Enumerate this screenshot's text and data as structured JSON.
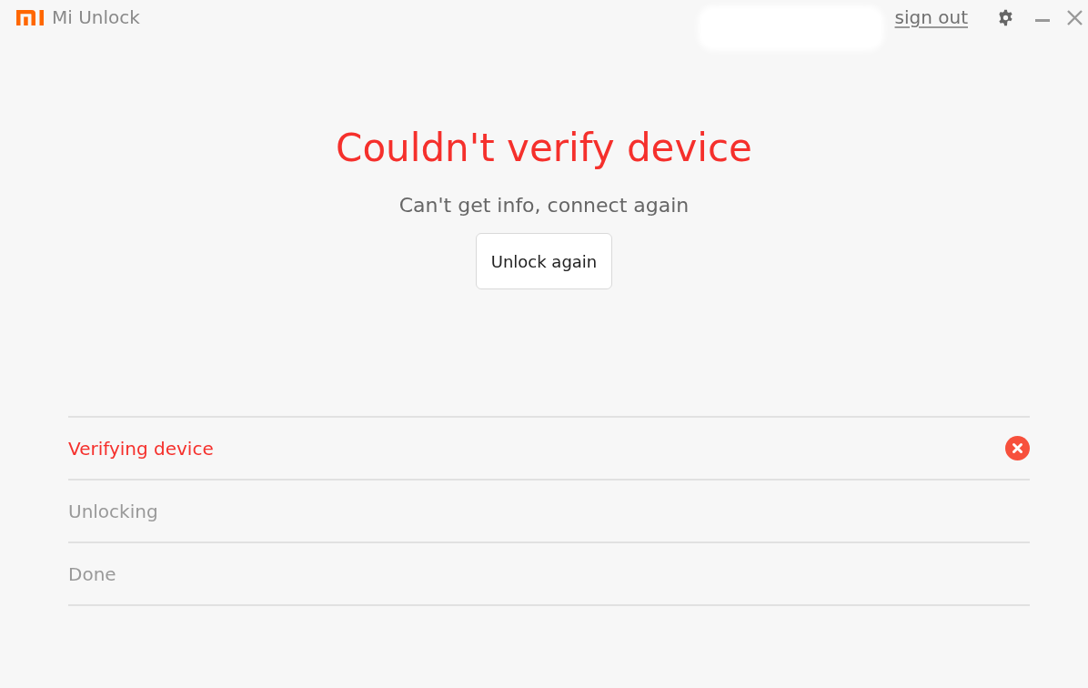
{
  "window": {
    "title": "Mi Unlock"
  },
  "account": {
    "sign_out": "sign out"
  },
  "message": {
    "title": "Couldn't verify device",
    "detail": "Can't get info, connect again",
    "button": "Unlock again"
  },
  "steps": [
    {
      "label": "Verifying device",
      "kind": "failed"
    },
    {
      "label": "Unlocking",
      "kind": "pending"
    },
    {
      "label": "Done",
      "kind": "pending"
    }
  ]
}
